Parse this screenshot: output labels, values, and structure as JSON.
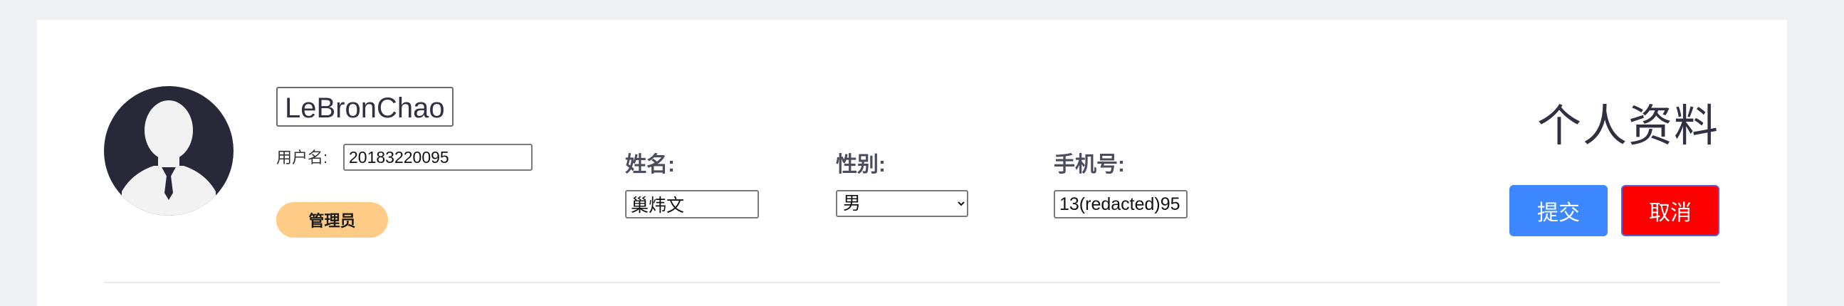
{
  "profile": {
    "username": "LeBronChao",
    "account_label": "用户名:",
    "account_value": "20183220095",
    "role_badge": "管理员"
  },
  "fields": {
    "name": {
      "label": "姓名:",
      "value": "巢炜文"
    },
    "gender": {
      "label": "性别:",
      "selected": "男",
      "options": [
        "男"
      ]
    },
    "phone": {
      "label": "手机号:",
      "value": "13(redacted)95"
    }
  },
  "header": {
    "title": "个人资料"
  },
  "actions": {
    "submit_label": "提交",
    "cancel_label": "取消"
  },
  "colors": {
    "avatar_bg": "#272838",
    "badge_bg": "#ffcc88",
    "submit_bg": "#3d87ff",
    "cancel_bg": "#ff0000",
    "cancel_border": "#5b5ed8"
  }
}
